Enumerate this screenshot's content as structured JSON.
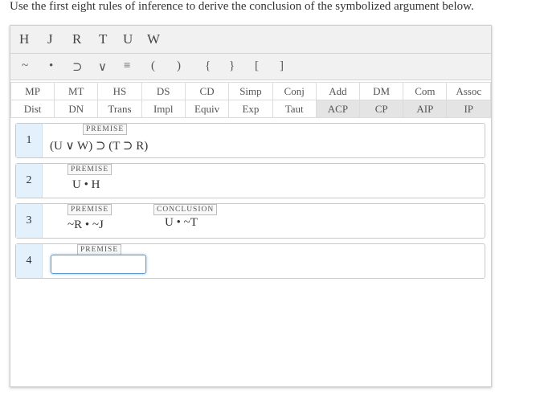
{
  "instructions": "Use the first eight rules of inference to derive the conclusion of the symbolized argument below.",
  "letters": [
    "H",
    "J",
    "R",
    "T",
    "U",
    "W"
  ],
  "symbols": [
    "~",
    "•",
    "⊃",
    "∨",
    "≡",
    "(",
    ")",
    "{",
    "}",
    "[",
    "]"
  ],
  "rules_row1": [
    "MP",
    "MT",
    "HS",
    "DS",
    "CD",
    "Simp",
    "Conj",
    "Add",
    "DM",
    "Com",
    "Assoc"
  ],
  "rules_row2": [
    "Dist",
    "DN",
    "Trans",
    "Impl",
    "Equiv",
    "Exp",
    "Taut",
    "ACP",
    "CP",
    "AIP",
    "IP"
  ],
  "lines": [
    {
      "number": "1",
      "badge": "PREMISE",
      "expr": "(U ∨ W) ⊃ (T ⊃ R)"
    },
    {
      "number": "2",
      "badge": "PREMISE",
      "expr": "U • H"
    },
    {
      "number": "3",
      "badge": "PREMISE",
      "expr": "~R • ~J",
      "conclusion_badge": "CONCLUSION",
      "conclusion": "U • ~T"
    },
    {
      "number": "4",
      "badge": "PREMISE",
      "input_value": ""
    }
  ]
}
